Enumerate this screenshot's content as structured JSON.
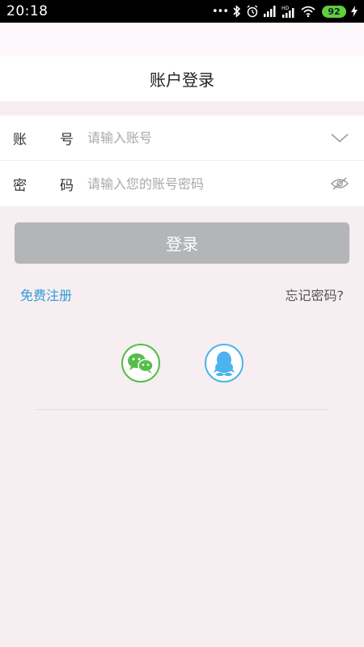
{
  "status_bar": {
    "time": "20:18",
    "dots": "•••",
    "icons": [
      "bluetooth-icon",
      "alarm-icon",
      "signal-icon",
      "hd-signal-icon",
      "wifi-icon",
      "battery-icon",
      "charging-icon"
    ],
    "battery_level": "92"
  },
  "navbar": {
    "title": "账户登录"
  },
  "form": {
    "account": {
      "label_a": "账",
      "label_b": "号",
      "placeholder": "请输入账号",
      "value": "",
      "icon": "chevron-down-icon"
    },
    "password": {
      "label_a": "密",
      "label_b": "码",
      "placeholder": "请输入您的账号密码",
      "value": "",
      "icon": "eye-hidden-icon"
    }
  },
  "actions": {
    "login_label": "登录",
    "register_label": "免费注册",
    "forgot_label": "忘记密码?"
  },
  "social": {
    "wechat_icon": "wechat-icon",
    "qq_icon": "qq-icon"
  },
  "colors": {
    "background": "#f6eef1",
    "button_disabled": "#b3b5b7",
    "link_blue": "#2e9ad8",
    "wechat_green": "#56bd4b",
    "qq_blue": "#4db3ee"
  }
}
